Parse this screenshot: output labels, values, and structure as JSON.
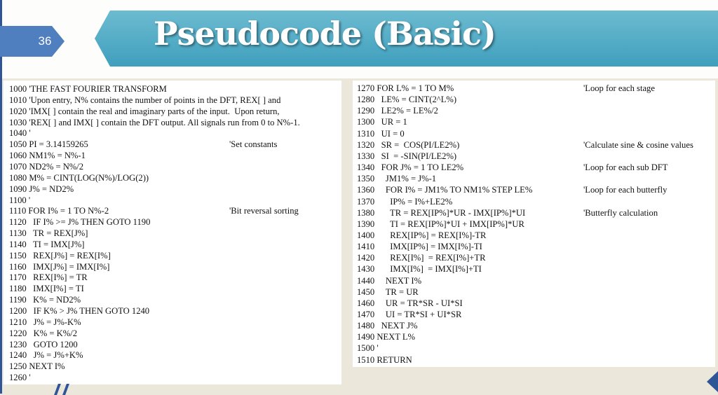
{
  "slide": {
    "number": "36",
    "title": "Pseudocode (Basic)"
  },
  "left": [
    {
      "n": "1000",
      "c": " 'THE FAST FOURIER TRANSFORM",
      "m": ""
    },
    {
      "n": "1010",
      "c": " 'Upon entry, N% contains the number of points in the DFT, REX[ ] and",
      "m": ""
    },
    {
      "n": "1020",
      "c": " 'IMX[ ] contain the real and imaginary parts of the input.  Upon return,",
      "m": ""
    },
    {
      "n": "1030",
      "c": " 'REX[ ] and IMX[ ] contain the DFT output. All signals run from 0 to N%-1.",
      "m": ""
    },
    {
      "n": "1040",
      "c": " '",
      "m": ""
    },
    {
      "n": "1050",
      "c": " PI = 3.14159265",
      "m": "'Set constants"
    },
    {
      "n": "1060",
      "c": " NM1% = N%-1",
      "m": ""
    },
    {
      "n": "1070",
      "c": " ND2% = N%/2",
      "m": ""
    },
    {
      "n": "1080",
      "c": " M% = CINT(LOG(N%)/LOG(2))",
      "m": ""
    },
    {
      "n": "1090",
      "c": " J% = ND2%",
      "m": ""
    },
    {
      "n": "1100",
      "c": " '",
      "m": ""
    },
    {
      "n": "1110",
      "c": " FOR I% = 1 TO N%-2",
      "m": "'Bit reversal sorting"
    },
    {
      "n": "1120",
      "c": "   IF I% >= J% THEN GOTO 1190",
      "m": ""
    },
    {
      "n": "1130",
      "c": "   TR = REX[J%]",
      "m": ""
    },
    {
      "n": "1140",
      "c": "   TI = IMX[J%]",
      "m": ""
    },
    {
      "n": "1150",
      "c": "   REX[J%] = REX[I%]",
      "m": ""
    },
    {
      "n": "1160",
      "c": "   IMX[J%] = IMX[I%]",
      "m": ""
    },
    {
      "n": "1170",
      "c": "   REX[I%] = TR",
      "m": ""
    },
    {
      "n": "1180",
      "c": "   IMX[I%] = TI",
      "m": ""
    },
    {
      "n": "1190",
      "c": "   K% = ND2%",
      "m": ""
    },
    {
      "n": "1200",
      "c": "   IF K% > J% THEN GOTO 1240",
      "m": ""
    },
    {
      "n": "1210",
      "c": "   J% = J%-K%",
      "m": ""
    },
    {
      "n": "1220",
      "c": "   K% = K%/2",
      "m": ""
    },
    {
      "n": "1230",
      "c": "   GOTO 1200",
      "m": ""
    },
    {
      "n": "1240",
      "c": "   J% = J%+K%",
      "m": ""
    },
    {
      "n": "1250",
      "c": " NEXT I%",
      "m": ""
    },
    {
      "n": "1260",
      "c": " '",
      "m": ""
    }
  ],
  "right": [
    {
      "n": "1270",
      "c": " FOR L% = 1 TO M%",
      "m": "'Loop for each stage"
    },
    {
      "n": "1280",
      "c": "   LE% = CINT(2^L%)",
      "m": ""
    },
    {
      "n": "1290",
      "c": "   LE2% = LE%/2",
      "m": ""
    },
    {
      "n": "1300",
      "c": "   UR = 1",
      "m": ""
    },
    {
      "n": "1310",
      "c": "   UI = 0",
      "m": ""
    },
    {
      "n": "1320",
      "c": "   SR =  COS(PI/LE2%)",
      "m": "'Calculate sine & cosine values"
    },
    {
      "n": "1330",
      "c": "   SI  = -SIN(PI/LE2%)",
      "m": ""
    },
    {
      "n": "1340",
      "c": "   FOR J% = 1 TO LE2%",
      "m": "'Loop for each sub DFT"
    },
    {
      "n": "1350",
      "c": "     JM1% = J%-1",
      "m": ""
    },
    {
      "n": "1360",
      "c": "     FOR I% = JM1% TO NM1% STEP LE%",
      "m": "'Loop for each butterfly"
    },
    {
      "n": "1370",
      "c": "       IP% = I%+LE2%",
      "m": ""
    },
    {
      "n": "1380",
      "c": "       TR = REX[IP%]*UR - IMX[IP%]*UI",
      "m": "'Butterfly calculation"
    },
    {
      "n": "1390",
      "c": "       TI = REX[IP%]*UI + IMX[IP%]*UR",
      "m": ""
    },
    {
      "n": "1400",
      "c": "       REX[IP%] = REX[I%]-TR",
      "m": ""
    },
    {
      "n": "1410",
      "c": "       IMX[IP%] = IMX[I%]-TI",
      "m": ""
    },
    {
      "n": "1420",
      "c": "       REX[I%]  = REX[I%]+TR",
      "m": ""
    },
    {
      "n": "1430",
      "c": "       IMX[I%]  = IMX[I%]+TI",
      "m": ""
    },
    {
      "n": "1440",
      "c": "     NEXT I%",
      "m": ""
    },
    {
      "n": "1450",
      "c": "     TR = UR",
      "m": ""
    },
    {
      "n": "1460",
      "c": "     UR = TR*SR - UI*SI",
      "m": ""
    },
    {
      "n": "1470",
      "c": "     UI = TR*SI + UI*SR",
      "m": ""
    },
    {
      "n": "1480",
      "c": "   NEXT J%",
      "m": ""
    },
    {
      "n": "1490",
      "c": " NEXT L%",
      "m": ""
    },
    {
      "n": "1500",
      "c": " '",
      "m": ""
    },
    {
      "n": "1510",
      "c": " RETURN",
      "m": ""
    }
  ]
}
